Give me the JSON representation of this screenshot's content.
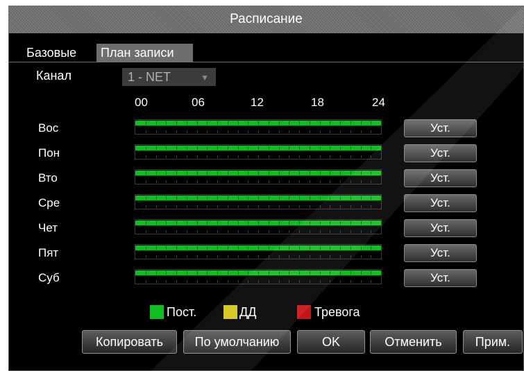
{
  "window": {
    "title": "Расписание"
  },
  "tabs": [
    {
      "label": "Базовые",
      "active": false
    },
    {
      "label": "План записи",
      "active": true
    }
  ],
  "channel": {
    "label": "Канал",
    "value": "1 - NET"
  },
  "timeline": {
    "hours": [
      "00",
      "06",
      "12",
      "18",
      "24"
    ]
  },
  "days": [
    {
      "label": "Вос",
      "set_label": "Уст.",
      "record_mode": "Пост.",
      "coverage": 1.0
    },
    {
      "label": "Пон",
      "set_label": "Уст.",
      "record_mode": "Пост.",
      "coverage": 1.0
    },
    {
      "label": "Вто",
      "set_label": "Уст.",
      "record_mode": "Пост.",
      "coverage": 1.0
    },
    {
      "label": "Сре",
      "set_label": "Уст.",
      "record_mode": "Пост.",
      "coverage": 1.0
    },
    {
      "label": "Чет",
      "set_label": "Уст.",
      "record_mode": "Пост.",
      "coverage": 1.0
    },
    {
      "label": "Пят",
      "set_label": "Уст.",
      "record_mode": "Пост.",
      "coverage": 1.0
    },
    {
      "label": "Суб",
      "set_label": "Уст.",
      "record_mode": "Пост.",
      "coverage": 1.0
    }
  ],
  "legend": [
    {
      "label": "Пост.",
      "color": "#0fbf1f"
    },
    {
      "label": "ДД",
      "color": "#d4c81a"
    },
    {
      "label": "Тревога",
      "color": "#c81414"
    }
  ],
  "buttons": {
    "copy": "Копировать",
    "default": "По умолчанию",
    "ok": "OK",
    "cancel": "Отменить",
    "apply": "Прим."
  },
  "colors": {
    "background": "#000000",
    "title_bar": "#747474",
    "active_tab": "#6e6e6e",
    "record_continuous": "#0fbf1f"
  }
}
